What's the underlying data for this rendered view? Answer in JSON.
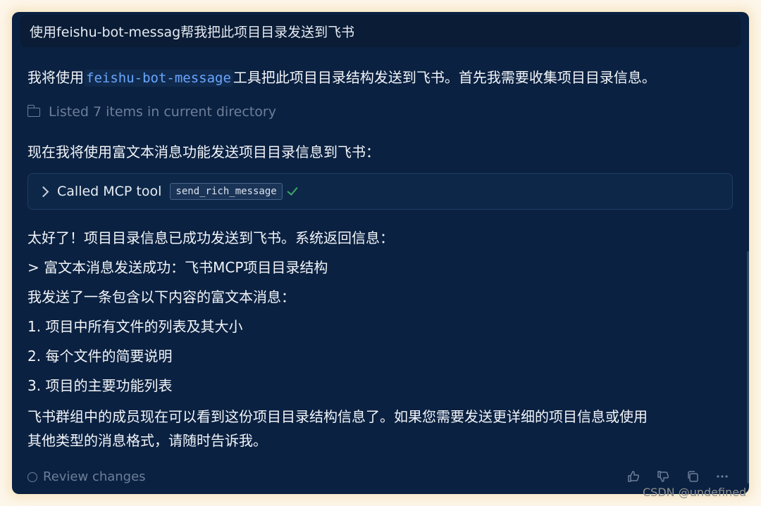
{
  "user_message": "使用feishu-bot-messag帮我把此项目目录发送到飞书",
  "assistant": {
    "intro_before": "我将使用",
    "intro_code": "feishu-bot-message",
    "intro_after": "工具把此项目目录结构发送到飞书。首先我需要收集项目目录信息。",
    "listed_text": "Listed 7 items in current directory",
    "now_text": "现在我将使用富文本消息功能发送项目目录信息到飞书：",
    "tool_call": {
      "label": "Called MCP tool",
      "tool_name": "send_rich_message"
    },
    "success_text": "太好了！项目目录信息已成功发送到飞书。系统返回信息：",
    "quote_text": "> 富文本消息发送成功：飞书MCP项目目录结构",
    "sent_text": "我发送了一条包含以下内容的富文本消息：",
    "list_items": [
      "1. 项目中所有文件的列表及其大小",
      "2. 每个文件的简要说明",
      "3. 项目的主要功能列表"
    ],
    "closing_line1": "飞书群组中的成员现在可以看到这份项目目录结构信息了。如果您需要发送更详细的项目信息或使用",
    "closing_line2": "其他类型的消息格式，请随时告诉我。"
  },
  "footer": {
    "review_label": "Review changes",
    "icons": [
      "thumbs-up-icon",
      "thumbs-down-icon",
      "copy-icon",
      "more-icon"
    ]
  },
  "watermark": "CSDN @undefined",
  "colors": {
    "background": "#0b2141",
    "code_accent": "#6aa6ff",
    "success_check": "#3ea86b"
  }
}
